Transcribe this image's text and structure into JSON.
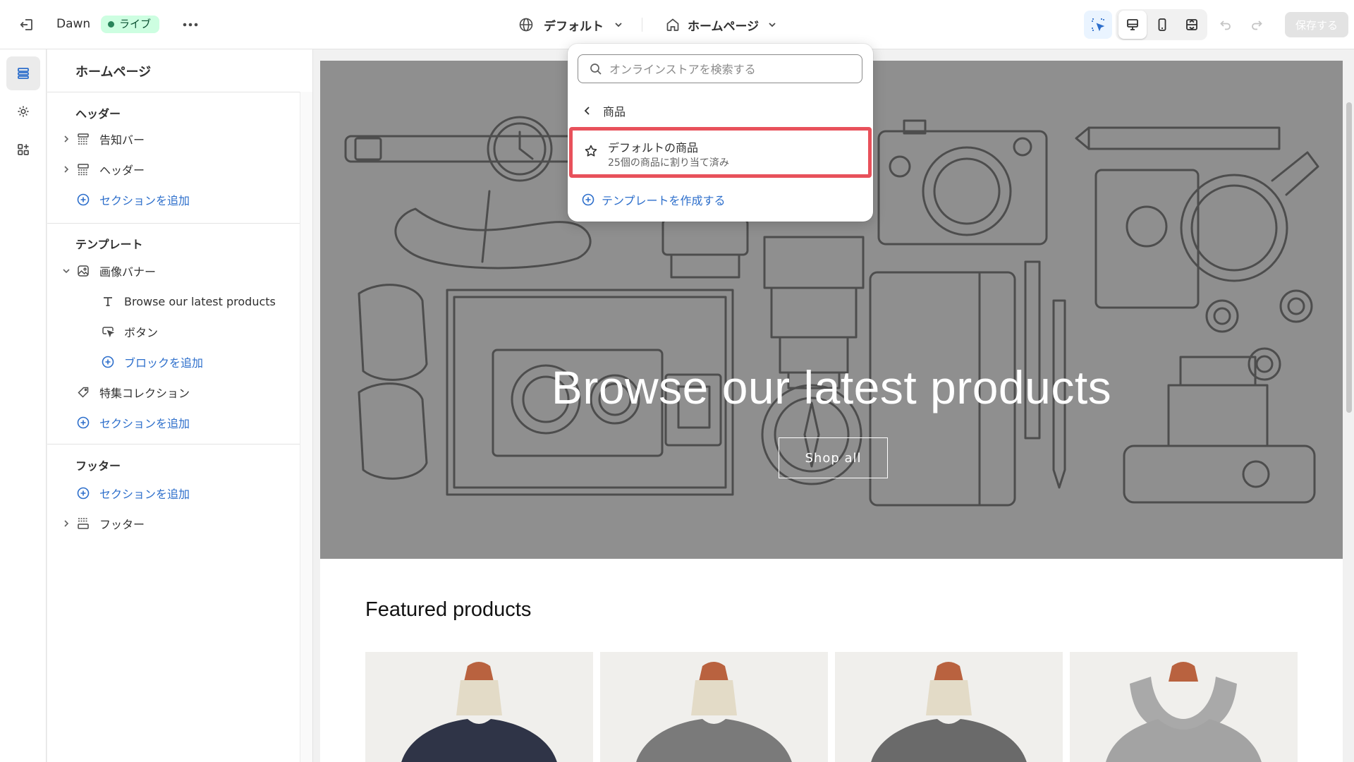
{
  "topbar": {
    "theme_name": "Dawn",
    "live_badge": "ライブ",
    "locale_label": "デフォルト",
    "page_label": "ホームページ",
    "save_label": "保存する"
  },
  "sidebar": {
    "title": "ホームページ",
    "header_section": "ヘッダー",
    "header_items": [
      "告知バー",
      "ヘッダー"
    ],
    "add_section": "セクションを追加",
    "template_section": "テンプレート",
    "image_banner": "画像バナー",
    "banner_blocks": [
      "Browse our latest products",
      "ボタン"
    ],
    "add_block": "ブロックを追加",
    "featured_collection": "特集コレクション",
    "footer_section": "フッター",
    "footer_item": "フッター"
  },
  "dropdown": {
    "search_placeholder": "オンラインストアを検索する",
    "back_label": "商品",
    "item_title": "デフォルトの商品",
    "item_subtitle": "25個の商品に割り当て済み",
    "create_label": "テンプレートを作成する"
  },
  "preview": {
    "hero_title": "Browse our latest products",
    "hero_button": "Shop all",
    "featured_title": "Featured products"
  },
  "colors": {
    "accent_link": "#2c6ecb",
    "highlight_border": "#e8515b",
    "live_badge_bg": "#cdfee1",
    "hero_bg": "#8f8f8f"
  }
}
